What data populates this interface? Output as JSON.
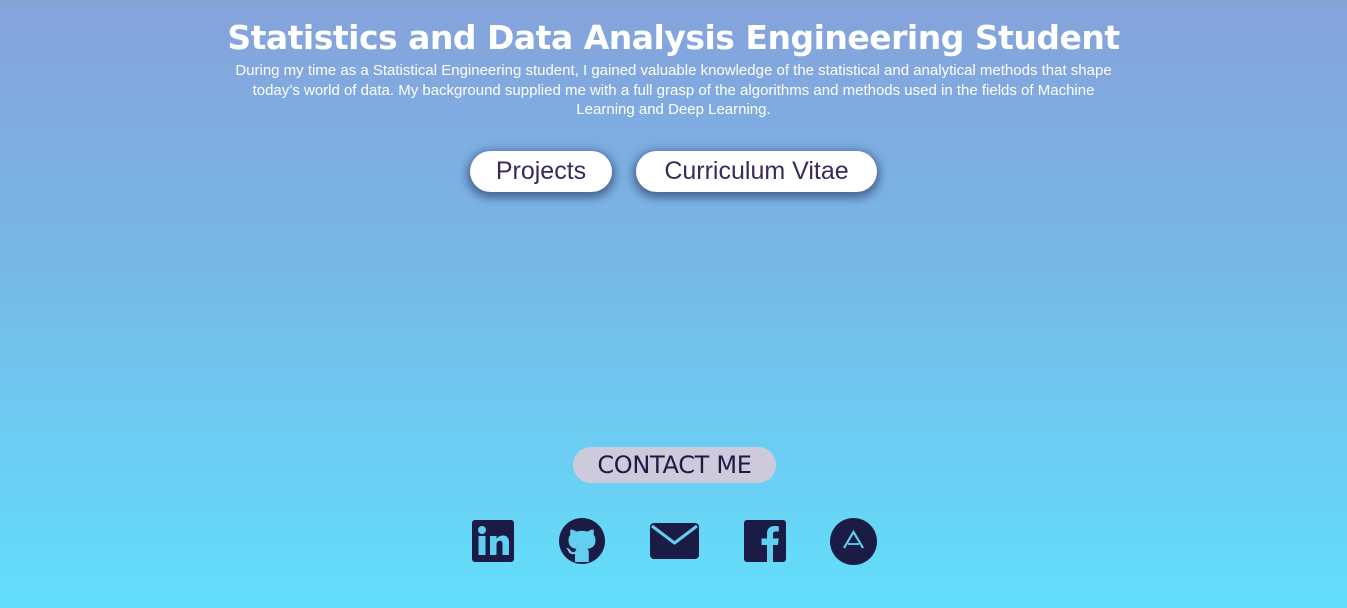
{
  "hero": {
    "title": "Statistics and Data Analysis Engineering Student",
    "description": "During my time as a Statistical Engineering student, I gained valuable knowledge of the statistical and analytical methods that shape today’s world of data. My background supplied me with a full grasp of the algorithms and methods used in the fields of Machine Learning and Deep Learning."
  },
  "buttons": {
    "projects": "Projects",
    "cv": "Curriculum Vitae"
  },
  "contact": {
    "label": "CONTACT ME"
  },
  "social_icons": [
    "linkedin-icon",
    "github-icon",
    "email-icon",
    "facebook-icon",
    "a-logo-icon"
  ],
  "colors": {
    "icon": "#1b1c45",
    "button_text": "#3a2a5c",
    "contact_bg": "#cdcbdb",
    "gradient_top": "#86a2db",
    "gradient_bottom": "#62dffb"
  }
}
